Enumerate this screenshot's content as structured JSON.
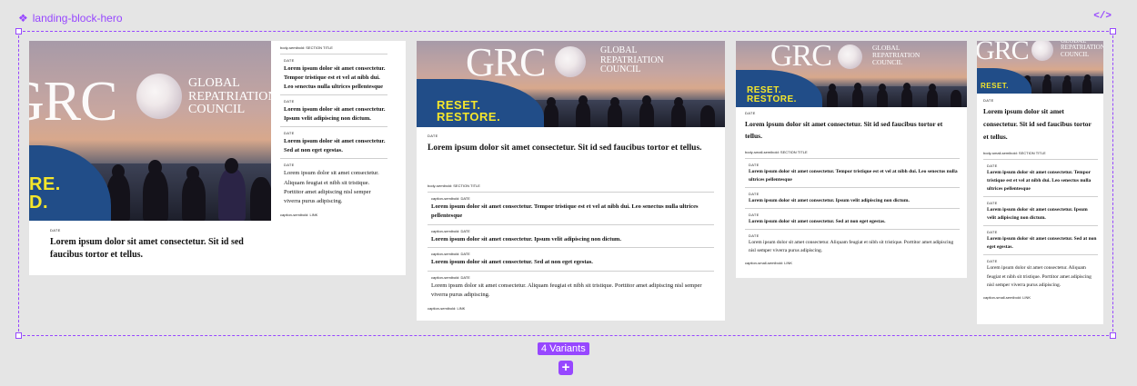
{
  "component": {
    "name": "landing-block-hero",
    "variants_badge": "4 Variants",
    "add_symbol": "+",
    "code_symbol": "</>",
    "accent_color": "#9747ff"
  },
  "hero": {
    "logo_text": "GRC",
    "org_line1": "GLOBAL",
    "org_line2": "REPATRIATION",
    "org_line3": "COUNCIL",
    "tagline1": "RESET.",
    "tagline2": "RESTORE.",
    "tagline_color": "#f5e62b",
    "wave_color": "#214d88"
  },
  "v1": {
    "tag1": "RE.",
    "tag2": "D.",
    "date": "DATE",
    "headline": "Lorem ipsum dolor sit amet consectetur. Sit id sed faucibus tortor et tellus.",
    "section_title": "body-semibold: SECTION TITLE",
    "items": [
      {
        "label": "DATE",
        "text": "Lorem ipsum dolor sit amet consectetur. Tempor tristique est et vel at nibh dui. Leo senectus nulla ultrices pellentesque"
      },
      {
        "label": "DATE",
        "text": "Lorem ipsum dolor sit amet consectetur. Ipsum velit adipiscing non dictum."
      },
      {
        "label": "DATE",
        "text": "Lorem ipsum dolor sit amet consectetur. Sed at non eget egestas."
      },
      {
        "label": "DATE",
        "text": "Lorem ipsum dolor sit amet consectetur. Aliquam feugiat et nibh sit tristique. Porttitor amet adipiscing nisl semper viverra purus adipiscing."
      }
    ],
    "link": "caption-semibold: LINK"
  },
  "v2": {
    "date": "DATE",
    "headline": "Lorem ipsum dolor sit amet consectetur. Sit id sed faucibus tortor et tellus.",
    "section_title": "body-semibold: SECTION TITLE",
    "items": [
      {
        "label": "caption-semibold: DATE",
        "text": "Lorem ipsum dolor sit amet consectetur. Tempor tristique est et vel at nibh dui. Leo senectus nulla ultrices pellentesque"
      },
      {
        "label": "caption-semibold: DATE",
        "text": "Lorem ipsum dolor sit amet consectetur. Ipsum velit adipiscing non dictum."
      },
      {
        "label": "caption-semibold: DATE",
        "text": "Lorem ipsum dolor sit amet consectetur. Sed at non eget egestas."
      },
      {
        "label": "caption-semibold: DATE",
        "text": "Lorem ipsum dolor sit amet consectetur. Aliquam feugiat et nibh sit tristique. Porttitor amet adipiscing nisl semper viverra purus adipiscing."
      }
    ],
    "link": "caption-semibold: LINK"
  },
  "v3": {
    "date": "DATE",
    "headline": "Lorem ipsum dolor sit amet consectetur. Sit id sed faucibus tortor et tellus.",
    "section_title": "body-small-semibold: SECTION TITLE",
    "items": [
      {
        "label": "DATE",
        "text": "Lorem ipsum dolor sit amet consectetur. Tempor tristique est et vel at nibh dui. Leo senectus nulla ultrices pellentesque"
      },
      {
        "label": "DATE",
        "text": "Lorem ipsum dolor sit amet consectetur. Ipsum velit adipiscing non dictum."
      },
      {
        "label": "DATE",
        "text": "Lorem ipsum dolor sit amet consectetur. Sed at non eget egestas."
      },
      {
        "label": "DATE",
        "text": "Lorem ipsum dolor sit amet consectetur. Aliquam feugiat et nibh sit tristique. Porttitor amet adipiscing nisl semper viverra purus adipiscing."
      }
    ],
    "link": "caption-small-semibold: LINK"
  },
  "v4": {
    "date": "DATE",
    "headline": "Lorem ipsum dolor sit amet consectetur. Sit id sed faucibus tortor et tellus.",
    "section_title": "body-small-semibold: SECTION TITLE",
    "items": [
      {
        "label": "DATE",
        "text": "Lorem ipsum dolor sit amet consectetur. Tempor tristique est et vel at nibh dui. Leo senectus nulla ultrices pellentesque"
      },
      {
        "label": "DATE",
        "text": "Lorem ipsum dolor sit amet consectetur. Ipsum velit adipiscing non dictum."
      },
      {
        "label": "DATE",
        "text": "Lorem ipsum dolor sit amet consectetur. Sed at non eget egestas."
      },
      {
        "label": "DATE",
        "text": "Lorem ipsum dolor sit amet consectetur. Aliquam feugiat et nibh sit tristique. Porttitor amet adipiscing nisl semper viverra purus adipiscing."
      }
    ],
    "link": "caption-small-semibold: LINK"
  }
}
